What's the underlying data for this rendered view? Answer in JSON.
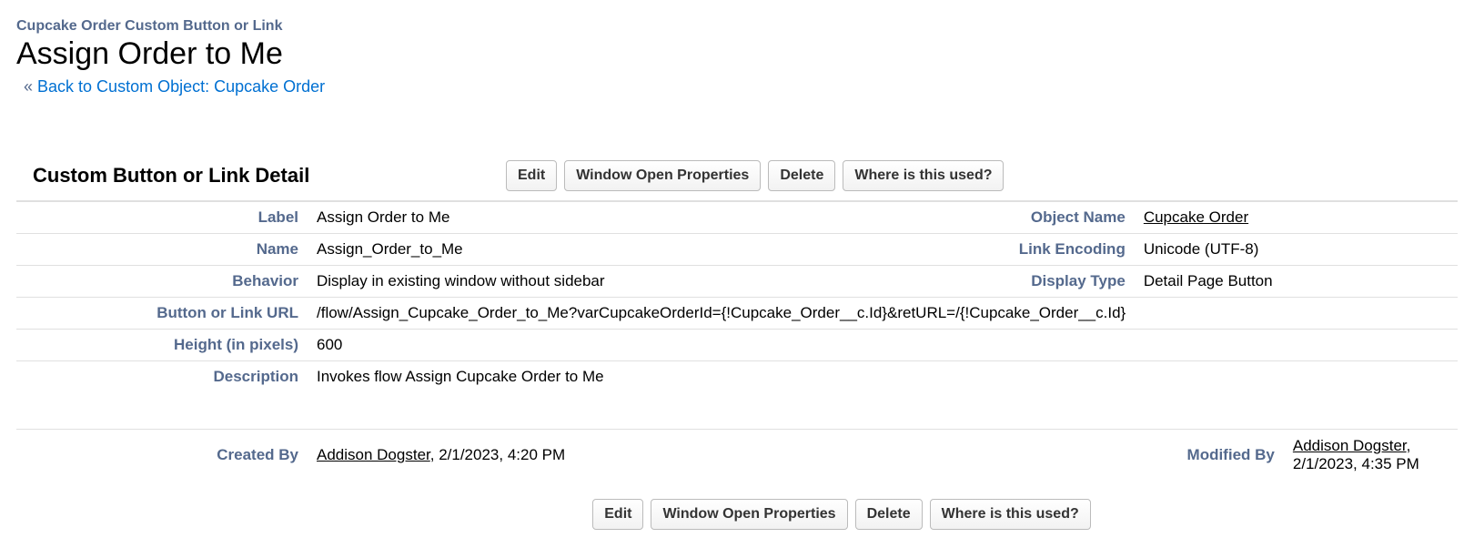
{
  "header": {
    "context": "Cupcake Order Custom Button or Link",
    "title": "Assign Order to Me",
    "back_chevron": "«",
    "back_label": "Back to Custom Object: Cupcake Order"
  },
  "section": {
    "title": "Custom Button or Link Detail"
  },
  "buttons": {
    "edit": "Edit",
    "window_open": "Window Open Properties",
    "delete": "Delete",
    "where_used": "Where is this used?"
  },
  "fields": {
    "label_lbl": "Label",
    "label_val": "Assign Order to Me",
    "object_name_lbl": "Object Name",
    "object_name_val": "Cupcake Order",
    "name_lbl": "Name",
    "name_val": "Assign_Order_to_Me",
    "link_encoding_lbl": "Link Encoding",
    "link_encoding_val": "Unicode (UTF-8)",
    "behavior_lbl": "Behavior",
    "behavior_val": "Display in existing window without sidebar",
    "display_type_lbl": "Display Type",
    "display_type_val": "Detail Page Button",
    "url_lbl": "Button or Link URL",
    "url_val": "/flow/Assign_Cupcake_Order_to_Me?varCupcakeOrderId={!Cupcake_Order__c.Id}&retURL=/{!Cupcake_Order__c.Id}",
    "height_lbl": "Height (in pixels)",
    "height_val": "600",
    "description_lbl": "Description",
    "description_val": "Invokes flow Assign Cupcake Order to Me"
  },
  "audit": {
    "created_by_lbl": "Created By",
    "created_by_name": "Addison Dogster",
    "created_by_date": ", 2/1/2023, 4:20 PM",
    "modified_by_lbl": "Modified By",
    "modified_by_name": "Addison Dogster",
    "modified_by_date": ", 2/1/2023, 4:35 PM"
  }
}
